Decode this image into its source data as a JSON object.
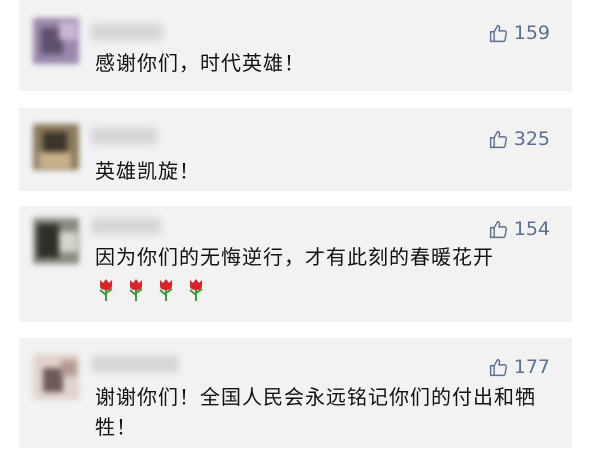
{
  "comments": [
    {
      "likes": "159",
      "text": "感谢你们，时代英雄！",
      "avatar_colors": [
        "#7b6a8e",
        "#9a87ab",
        "#c9b6d4",
        "#5d4f6d"
      ]
    },
    {
      "likes": "325",
      "text": "英雄凯旋！",
      "avatar_colors": [
        "#5a5040",
        "#8b7a5c",
        "#c8b08a",
        "#3b342a"
      ]
    },
    {
      "likes": "154",
      "text": "因为你们的无悔逆行，才有此刻的春暖花开",
      "emoji_icons": [
        "rose-icon",
        "rose-icon",
        "rose-icon",
        "rose-icon"
      ],
      "avatar_colors": [
        "#4a4a44",
        "#8a8a80",
        "#d6d6cc",
        "#2f2f2a"
      ]
    },
    {
      "likes": "177",
      "text": "谢谢你们！全国人民会永远铭记你们的付出和牺牲！",
      "avatar_colors": [
        "#6e5a58",
        "#b49a92",
        "#e2d2cc",
        "#4a3c3a"
      ]
    }
  ],
  "colors": {
    "card_bg": "#f2f2f2",
    "like_color": "#5b6f8f",
    "text_color": "#111111",
    "rose_red": "#d8232a",
    "rose_green": "#3e9b3a"
  }
}
